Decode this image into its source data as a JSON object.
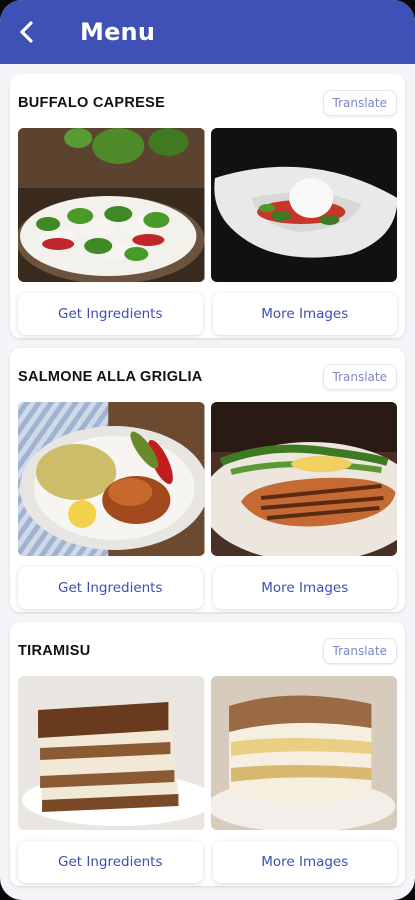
{
  "header": {
    "title": "Menu",
    "back_icon": "chevron-left-icon",
    "bg_color": "#3f51b5"
  },
  "dishes": [
    {
      "name": "BUFFALO CAPRESE",
      "translate_label": "Translate",
      "ingredients_label": "Get Ingredients",
      "more_images_label": "More Images"
    },
    {
      "name": "SALMONE ALLA GRIGLIA",
      "translate_label": "Translate",
      "ingredients_label": "Get Ingredients",
      "more_images_label": "More Images"
    },
    {
      "name": "TIRAMISU",
      "translate_label": "Translate",
      "ingredients_label": "Get Ingredients",
      "more_images_label": "More Images"
    }
  ]
}
